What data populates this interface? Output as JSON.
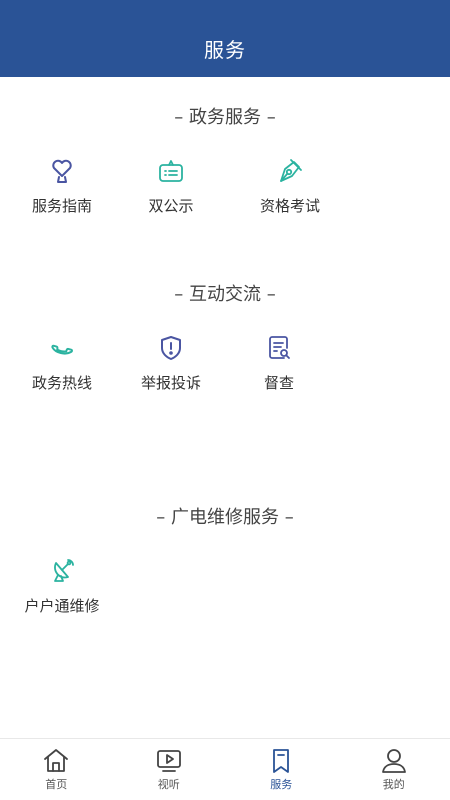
{
  "header": {
    "title": "服务"
  },
  "sections": [
    {
      "title": "– 政务服务 –",
      "items": [
        {
          "label": "服务指南",
          "icon": "heart-trophy-icon",
          "color": "#4a55a2"
        },
        {
          "label": "双公示",
          "icon": "signboard-icon",
          "color": "#2bb3a0"
        },
        {
          "label": "资格考试",
          "icon": "pen-nib-icon",
          "color": "#2bb3a0"
        }
      ]
    },
    {
      "title": "– 互动交流 –",
      "items": [
        {
          "label": "政务热线",
          "icon": "phone-icon",
          "color": "#2bb3a0"
        },
        {
          "label": "举报投诉",
          "icon": "shield-alert-icon",
          "color": "#4a55a2"
        },
        {
          "label": "督查",
          "icon": "document-search-icon",
          "color": "#4a55a2"
        }
      ]
    },
    {
      "title": "– 广电维修服务 –",
      "items": [
        {
          "label": "户户通维修",
          "icon": "satellite-dish-icon",
          "color": "#2bb3a0"
        }
      ]
    }
  ],
  "tabbar": {
    "active": "服务",
    "active_color": "#2a5396",
    "items": [
      {
        "label": "首页",
        "icon": "home-icon"
      },
      {
        "label": "视听",
        "icon": "video-play-icon"
      },
      {
        "label": "服务",
        "icon": "bookmark-icon"
      },
      {
        "label": "我的",
        "icon": "user-icon"
      }
    ]
  }
}
